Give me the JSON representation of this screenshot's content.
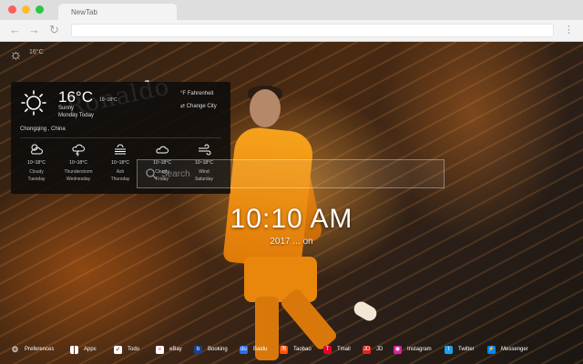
{
  "browser": {
    "tab_title": "NewTab",
    "back_icon": "arrow-left-icon",
    "forward_icon": "arrow-right-icon",
    "reload_icon": "reload-icon"
  },
  "wallpaper": {
    "big_text": "Ronaldo"
  },
  "mini_weather": {
    "icon": "sun-icon",
    "temp": "16°C"
  },
  "weather": {
    "temp": "16°C",
    "range": "10~18°C",
    "condition": "Sunny",
    "day": "Monday Today",
    "unit_toggle": "°F Fahrenheit",
    "change_city": "⇄ Change City",
    "location": "Chongqing , China",
    "forecast": [
      {
        "icon": "cloudy-icon",
        "range": "10~18°C",
        "condition": "Cloudy",
        "day": "Tuesday"
      },
      {
        "icon": "thunderstorm-icon",
        "range": "10~18°C",
        "condition": "Thunderstorm",
        "day": "Wednesday"
      },
      {
        "icon": "ash-icon",
        "range": "10~18°C",
        "condition": "Ash",
        "day": "Thursday"
      },
      {
        "icon": "cloud-icon",
        "range": "10~18°C",
        "condition": "Cloudy",
        "day": "Friday"
      },
      {
        "icon": "wind-icon",
        "range": "10~18°C",
        "condition": "Wind",
        "day": "Saturday"
      }
    ]
  },
  "search": {
    "placeholder": "Search"
  },
  "clock": {
    "time": "10:10 AM",
    "date": "2017 ... on"
  },
  "bottom_bar": [
    {
      "label": "Preferences",
      "icon": "gear-icon",
      "color": "#ffffff"
    },
    {
      "label": "Apps",
      "icon": "grid-icon",
      "color": "#ffffff"
    },
    {
      "label": "Todo",
      "icon": "checkbox-icon",
      "color": "#ffffff"
    },
    {
      "label": "eBay",
      "icon": "ebay-icon",
      "color": "#ffffff"
    },
    {
      "label": "Booking",
      "icon": "booking-icon",
      "color": "#1b3f94"
    },
    {
      "label": "Baidu",
      "icon": "baidu-icon",
      "color": "#2a6ee8"
    },
    {
      "label": "Taobao",
      "icon": "taobao-icon",
      "color": "#ff5000"
    },
    {
      "label": "Tmall",
      "icon": "tmall-icon",
      "color": "#e4002b"
    },
    {
      "label": "JD",
      "icon": "jd-icon",
      "color": "#e1251b"
    },
    {
      "label": "Instagram",
      "icon": "instagram-icon",
      "color": "#d6249f"
    },
    {
      "label": "Twitter",
      "icon": "twitter-icon",
      "color": "#1da1f2"
    },
    {
      "label": "Messenger",
      "icon": "messenger-icon",
      "color": "#0084ff"
    }
  ]
}
